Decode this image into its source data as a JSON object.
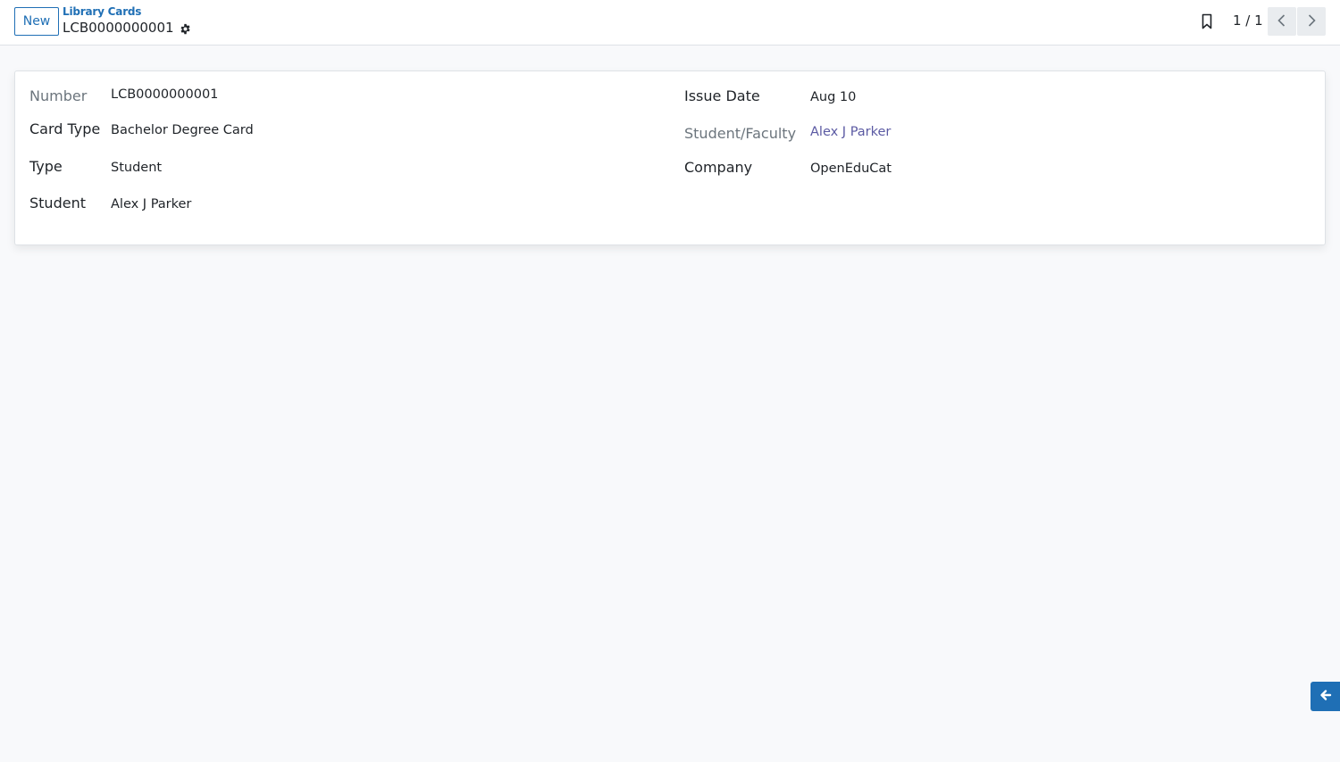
{
  "header": {
    "new_button_label": "New",
    "breadcrumb": "Library Cards",
    "record_name": "LCB0000000001",
    "pager": "1 / 1"
  },
  "icons": {
    "settings": "gear-icon",
    "bookmark": "bookmark-icon",
    "previous": "chevron-left-icon",
    "next": "chevron-right-icon",
    "side_toggle": "arrow-left-icon"
  },
  "form": {
    "left": [
      {
        "label": "Number",
        "value": "LCB0000000001"
      },
      {
        "label": "Card Type",
        "value": "Bachelor Degree Card"
      },
      {
        "label": "Type",
        "value": "Student"
      },
      {
        "label": "Student",
        "value": "Alex J Parker"
      }
    ],
    "right": [
      {
        "label": "Issue Date",
        "value": "Aug 10"
      },
      {
        "label": "Student/Faculty",
        "value": "Alex J Parker"
      },
      {
        "label": "Company",
        "value": "OpenEduCat"
      }
    ]
  },
  "colors": {
    "accent": "#1f6fb5",
    "link": "#5b5aa3",
    "muted_label": "#6c757d",
    "background": "#f8f9fb"
  }
}
